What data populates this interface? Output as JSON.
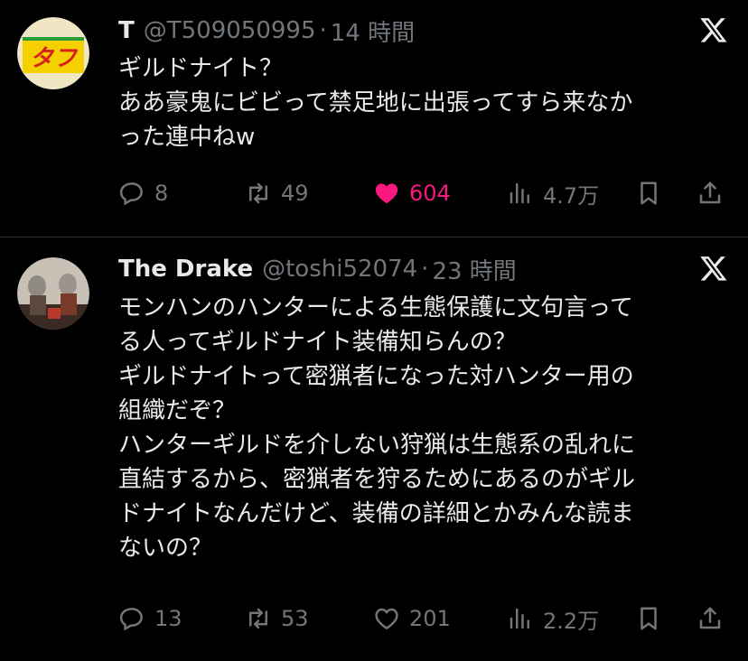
{
  "tweets": [
    {
      "name": "T",
      "handle": "@T509050995",
      "separator": "·",
      "time": "14 時間",
      "avatar_text": "タフ",
      "lines": [
        "ギルドナイト？",
        "ああ豪鬼にビビって禁足地に出張ってすら来なか",
        "った連中ねw"
      ],
      "replies": "8",
      "reposts": "49",
      "likes": "604",
      "liked": true,
      "views": "4.7万"
    },
    {
      "name": "The Drake",
      "handle": "@toshi52074",
      "separator": "·",
      "time": "23 時間",
      "lines": [
        "モンハンのハンターによる生態保護に文句言って",
        "る人ってギルドナイト装備知らんの？",
        "ギルドナイトって密猟者になった対ハンター用の",
        "組織だぞ？",
        "ハンターギルドを介しない狩猟は生態系の乱れに",
        "直結するから、密猟者を狩るためにあるのがギル",
        "ドナイトなんだけど、装備の詳細とかみんな読ま",
        "ないの？"
      ],
      "replies": "13",
      "reposts": "53",
      "likes": "201",
      "liked": false,
      "views": "2.2万"
    }
  ],
  "colors": {
    "background": "#000000",
    "text": "#e7e9ea",
    "muted": "#71767b",
    "like_active": "#f91880",
    "divider": "#2f3336"
  }
}
